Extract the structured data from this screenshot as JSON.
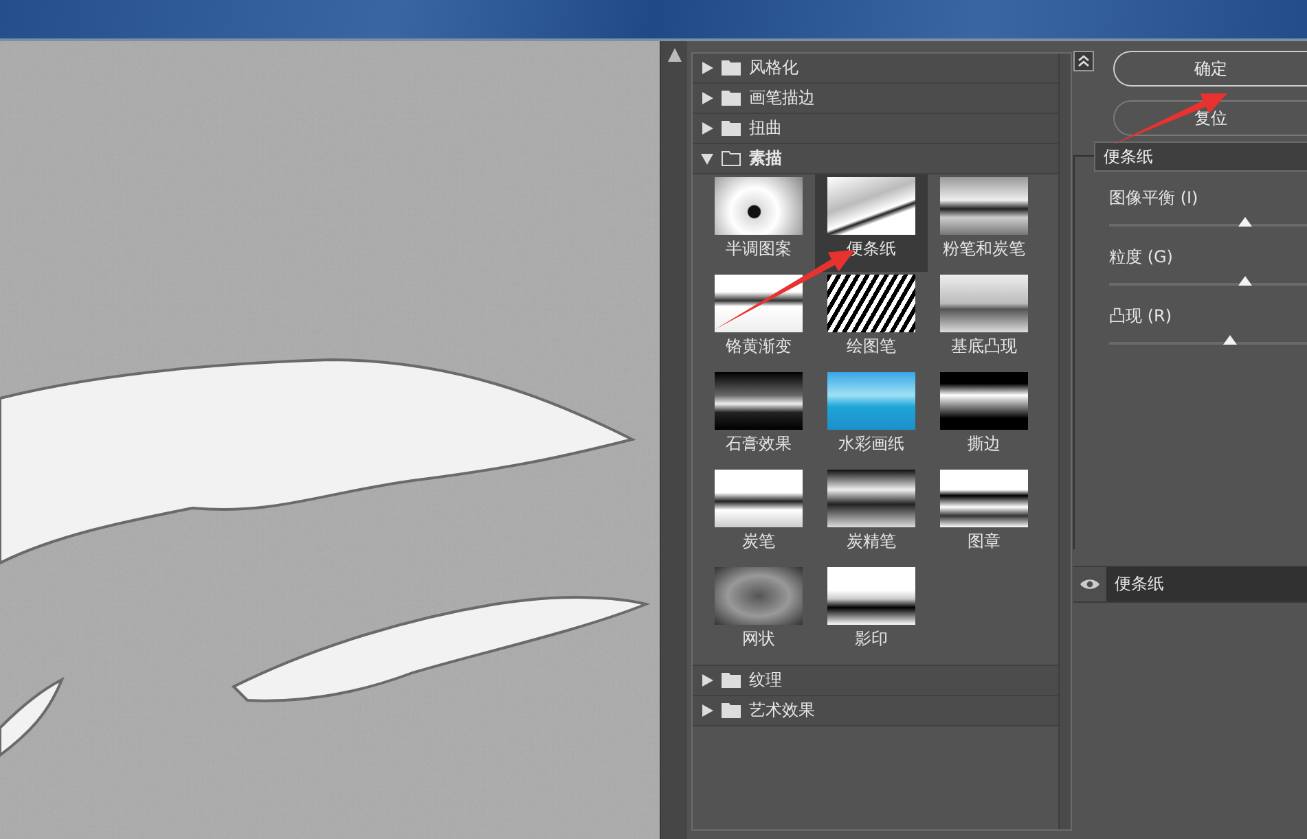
{
  "categories": [
    {
      "label": "风格化",
      "expanded": false
    },
    {
      "label": "画笔描边",
      "expanded": false
    },
    {
      "label": "扭曲",
      "expanded": false
    },
    {
      "label": "素描",
      "expanded": true,
      "filters": [
        {
          "label": "半调图案",
          "selected": false
        },
        {
          "label": "便条纸",
          "selected": true
        },
        {
          "label": "粉笔和炭笔",
          "selected": false
        },
        {
          "label": "铬黄渐变",
          "selected": false
        },
        {
          "label": "绘图笔",
          "selected": false
        },
        {
          "label": "基底凸现",
          "selected": false
        },
        {
          "label": "石膏效果",
          "selected": false
        },
        {
          "label": "水彩画纸",
          "selected": false
        },
        {
          "label": "撕边",
          "selected": false
        },
        {
          "label": "炭笔",
          "selected": false
        },
        {
          "label": "炭精笔",
          "selected": false
        },
        {
          "label": "图章",
          "selected": false
        },
        {
          "label": "网状",
          "selected": false
        },
        {
          "label": "影印",
          "selected": false
        }
      ]
    },
    {
      "label": "纹理",
      "expanded": false
    },
    {
      "label": "艺术效果",
      "expanded": false
    }
  ],
  "buttons": [
    {
      "label": "确定",
      "default": true
    },
    {
      "label": "复位",
      "default": false
    }
  ],
  "filter_select": {
    "value": "便条纸"
  },
  "settings": [
    {
      "label": "图像平衡 (I)",
      "level": 0.69
    },
    {
      "label": "粒度 (G)",
      "level": 0.69
    },
    {
      "label": "凸现 (R)",
      "level": 0.61
    }
  ],
  "layers": [
    {
      "label": "便条纸",
      "visible": true
    }
  ]
}
